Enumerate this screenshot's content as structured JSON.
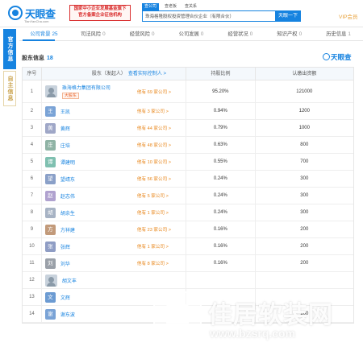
{
  "header": {
    "logo_name": "天眼查",
    "logo_url": "TianYanCha.com",
    "gov_badge_line1": "国家中小企业发展基金旗下",
    "gov_badge_line2": "官方备案企业征信机构",
    "search_tabs": [
      "查公司",
      "查老板",
      "查关系"
    ],
    "search_value": "珠海格隆股权投资管理合伙企业（有限合伙）",
    "search_button": "天眼一下",
    "vip_label": "VIP会员"
  },
  "side_tabs": {
    "primary": "官方信息",
    "secondary": "自主信息"
  },
  "nav": {
    "items": [
      {
        "label": "公司背景",
        "count": "25"
      },
      {
        "label": "司法风险",
        "count": "0"
      },
      {
        "label": "经营风险",
        "count": "0"
      },
      {
        "label": "公司发展",
        "count": "0"
      },
      {
        "label": "经营状况",
        "count": "0"
      },
      {
        "label": "知识产权",
        "count": "0"
      },
      {
        "label": "历史信息",
        "count": "1"
      }
    ]
  },
  "section": {
    "title": "股东信息",
    "count": "18",
    "logo": "天眼查"
  },
  "table": {
    "headers": {
      "index": "序号",
      "name": "股东（发起人）",
      "name_link": "查看实际控制人 >",
      "ratio": "持股比例",
      "amount": "认缴出资额"
    },
    "rows": [
      {
        "idx": "1",
        "avatar": "",
        "name": "珠海格力集团有限公司",
        "tag": "大股东",
        "holding": "他有 69 家公司 >",
        "ratio": "95.20%",
        "amount": "121000"
      },
      {
        "idx": "2",
        "avatar": "王",
        "name": "王凯",
        "tag": "",
        "holding": "他有 3 家公司 >",
        "ratio": "0.94%",
        "amount": "1200"
      },
      {
        "idx": "3",
        "avatar": "黄",
        "name": "黄辉",
        "tag": "",
        "holding": "他有 44 家公司 >",
        "ratio": "0.79%",
        "amount": "1000"
      },
      {
        "idx": "4",
        "avatar": "庄",
        "name": "庄培",
        "tag": "",
        "holding": "他有 48 家公司 >",
        "ratio": "0.63%",
        "amount": "800"
      },
      {
        "idx": "5",
        "avatar": "谭",
        "name": "谭建明",
        "tag": "",
        "holding": "他有 10 家公司 >",
        "ratio": "0.55%",
        "amount": "700"
      },
      {
        "idx": "6",
        "avatar": "望",
        "name": "望靖东",
        "tag": "",
        "holding": "他有 56 家公司 >",
        "ratio": "0.24%",
        "amount": "300"
      },
      {
        "idx": "7",
        "avatar": "赵",
        "name": "赵志伟",
        "tag": "",
        "holding": "他有 5 家公司 >",
        "ratio": "0.24%",
        "amount": "300"
      },
      {
        "idx": "8",
        "avatar": "胡",
        "name": "胡余生",
        "tag": "",
        "holding": "他有 1 家公司 >",
        "ratio": "0.24%",
        "amount": "300"
      },
      {
        "idx": "9",
        "avatar": "方",
        "name": "方祥建",
        "tag": "",
        "holding": "他有 23 家公司 >",
        "ratio": "0.16%",
        "amount": "200"
      },
      {
        "idx": "10",
        "avatar": "张",
        "name": "张辉",
        "tag": "",
        "holding": "他有 1 家公司 >",
        "ratio": "0.16%",
        "amount": "200"
      },
      {
        "idx": "11",
        "avatar": "刘",
        "name": "刘华",
        "tag": "",
        "holding": "他有 8 家公司 >",
        "ratio": "0.16%",
        "amount": "200"
      },
      {
        "idx": "12",
        "avatar": "",
        "name": "胡文丰",
        "tag": "",
        "holding": "",
        "ratio": "",
        "amount": ""
      },
      {
        "idx": "13",
        "avatar": "文",
        "name": "文辉",
        "tag": "",
        "holding": "",
        "ratio": "",
        "amount": ""
      },
      {
        "idx": "14",
        "avatar": "谢",
        "name": "谢东波",
        "tag": "",
        "holding": "",
        "ratio": "",
        "amount": "100"
      }
    ]
  },
  "watermark": {
    "title": "佳居软装网",
    "url": "www.bzsrq.com"
  },
  "colors": {
    "brand_blue": "#1683e0",
    "orange": "#e8861a",
    "red": "#d92e2e",
    "avatar_colors": [
      "#7aa3d6",
      "#9fa7c7",
      "#8fb3a5",
      "#7fc0b0",
      "#8aa0c8",
      "#b0a2cf",
      "#a7b3c4",
      "#c29a7a",
      "#8f9dc4",
      "#9aa0a8",
      "#6c9bd2"
    ]
  }
}
